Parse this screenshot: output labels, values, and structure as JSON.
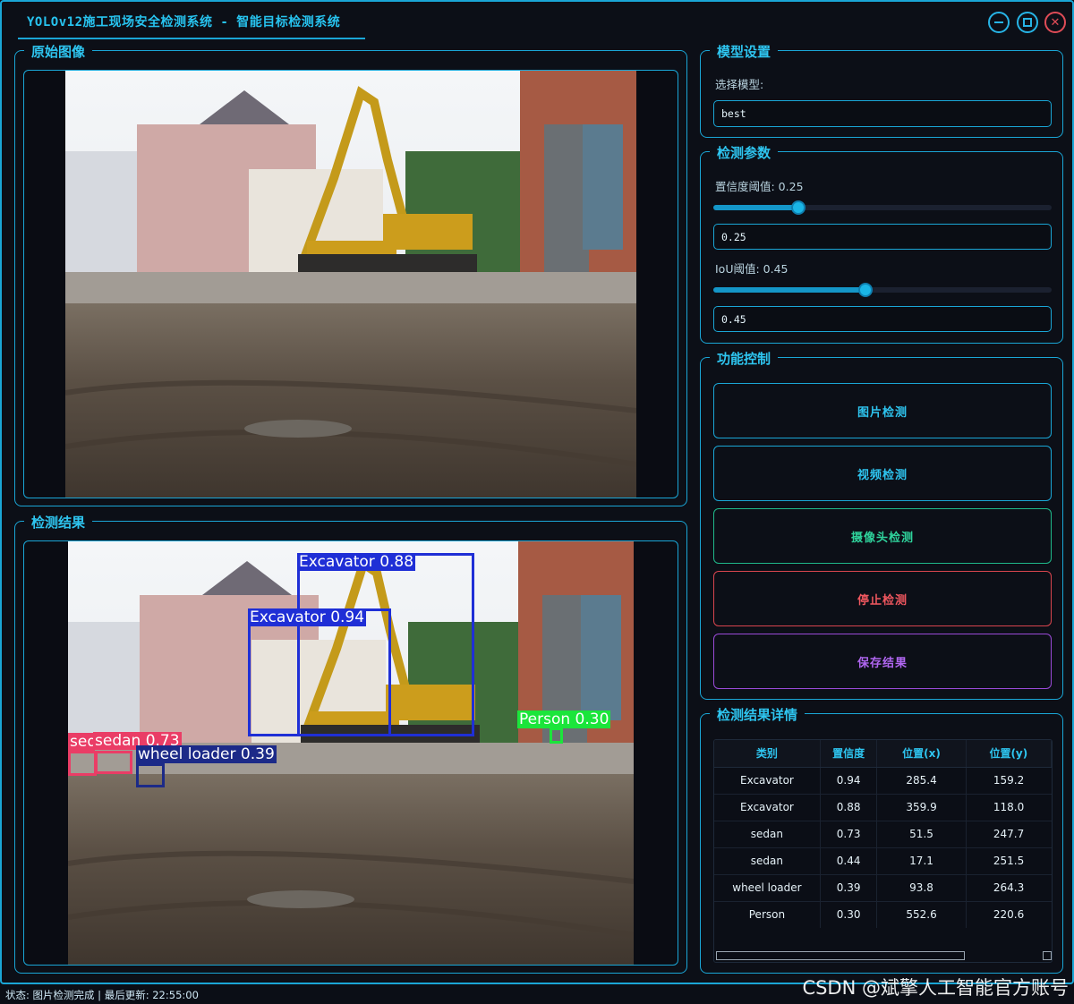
{
  "window": {
    "title": "YOLOv12施工现场安全检测系统 - 智能目标检测系统"
  },
  "original": {
    "title": "原始图像"
  },
  "result": {
    "title": "检测结果",
    "detections": [
      {
        "label": "Excavator 0.88",
        "color": "#1f2fd6"
      },
      {
        "label": "Excavator 0.94",
        "color": "#1f2fd6"
      },
      {
        "label": "Person 0.30",
        "color": "#1be53b"
      },
      {
        "label": "sedan 0.73",
        "color": "#ea3d66"
      },
      {
        "label": "sedan",
        "color": "#ea3d66"
      },
      {
        "label": "wheel loader 0.39",
        "color": "#1c2a88"
      }
    ]
  },
  "model": {
    "title": "模型设置",
    "select_label": "选择模型:",
    "selected": "best"
  },
  "params": {
    "title": "检测参数",
    "conf_label": "置信度阈值: 0.25",
    "conf_value": "0.25",
    "conf_level": 0.25,
    "iou_label": "IoU阈值: 0.45",
    "iou_value": "0.45",
    "iou_level": 0.45
  },
  "controls": {
    "title": "功能控制",
    "image_detect": "图片检测",
    "video_detect": "视频检测",
    "camera_detect": "摄像头检测",
    "stop_detect": "停止检测",
    "save_result": "保存结果"
  },
  "details": {
    "title": "检测结果详情",
    "headers": [
      "类别",
      "置信度",
      "位置(x)",
      "位置(y)"
    ],
    "rows": [
      [
        "Excavator",
        "0.94",
        "285.4",
        "159.2"
      ],
      [
        "Excavator",
        "0.88",
        "359.9",
        "118.0"
      ],
      [
        "sedan",
        "0.73",
        "51.5",
        "247.7"
      ],
      [
        "sedan",
        "0.44",
        "17.1",
        "251.5"
      ],
      [
        "wheel loader",
        "0.39",
        "93.8",
        "264.3"
      ],
      [
        "Person",
        "0.30",
        "552.6",
        "220.6"
      ]
    ]
  },
  "status": "状态: 图片检测完成 | 最后更新: 22:55:00",
  "watermark": "CSDN @斌擎人工智能官方账号"
}
